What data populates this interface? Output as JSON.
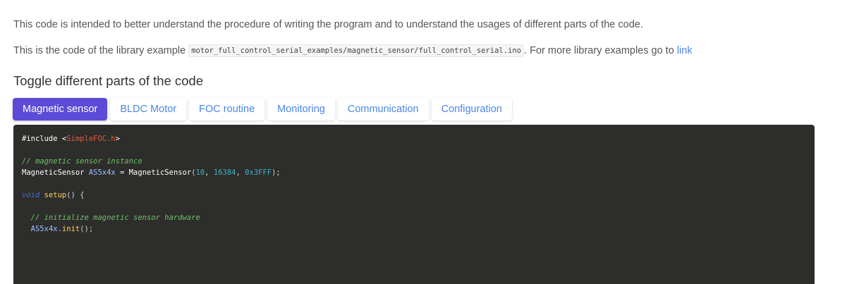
{
  "intro": {
    "text": "This code is intended to better understand the procedure of writing the program and to understand the usages of different parts of the code."
  },
  "example": {
    "prefix": "This is the code of the library example ",
    "path": "motor_full_control_serial_examples/magnetic_sensor/full_control_serial.ino",
    "suffix": ". For more library examples go to ",
    "link_label": "link"
  },
  "section": {
    "heading": "Toggle different parts of the code"
  },
  "tabs": [
    {
      "label": "Magnetic sensor",
      "active": true
    },
    {
      "label": "BLDC Motor",
      "active": false
    },
    {
      "label": "FOC routine",
      "active": false
    },
    {
      "label": "Monitoring",
      "active": false
    },
    {
      "label": "Communication",
      "active": false
    },
    {
      "label": "Configuration",
      "active": false
    }
  ],
  "code": {
    "line1": {
      "a": "#include <",
      "b": "SimpleFOC.h",
      "c": ">"
    },
    "line3": {
      "comment": "// magnetic sensor instance"
    },
    "line4": {
      "type": "MagneticSensor ",
      "var": "AS5x4x",
      "eq": " = MagneticSensor",
      "p1": "(",
      "n1": "10",
      "c1": ", ",
      "n2": "16384",
      "c2": ", ",
      "n3": "0x3FFF",
      "p2": ");"
    },
    "line6": {
      "kw": "void",
      "fn": " setup",
      "rest": "() {"
    },
    "line8": {
      "comment": "  // initialize magnetic sensor hardware"
    },
    "line9": {
      "indent": "  ",
      "var": "AS5x4x",
      "dot": ".",
      "fn": "init",
      "rest": "();"
    }
  },
  "colors": {
    "active_tab": "#5b4bd6",
    "link": "#4a86e8",
    "code_bg": "#2d2d2b"
  }
}
